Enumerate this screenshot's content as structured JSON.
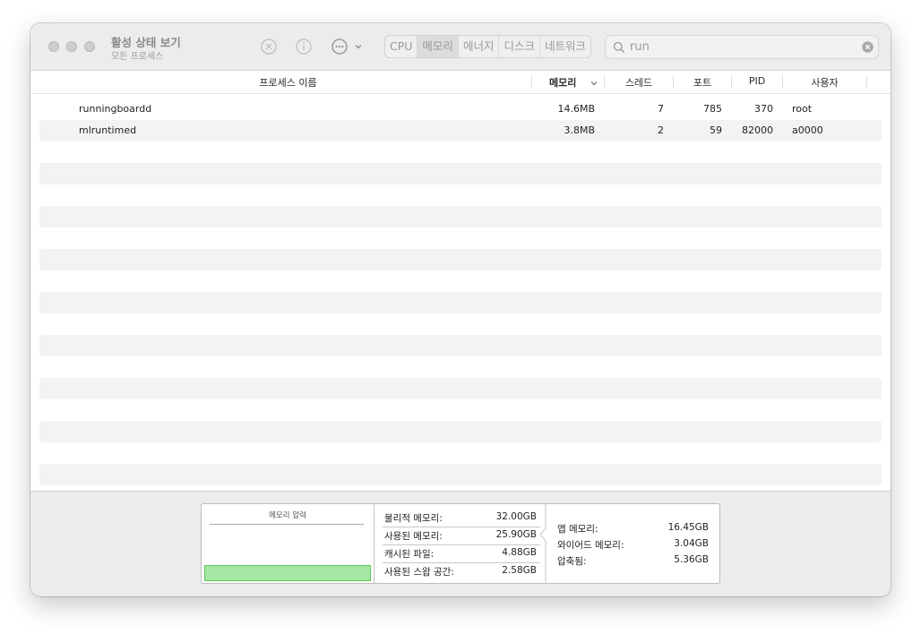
{
  "titlebar": {
    "title": "활성 상태 보기",
    "subtitle": "모든 프로세스",
    "icons": [
      "close-circle-icon",
      "info-icon",
      "more-icon",
      "chevron-down-icon"
    ]
  },
  "tabs": [
    {
      "label": "CPU",
      "active": false
    },
    {
      "label": "메모리",
      "active": true
    },
    {
      "label": "에너지",
      "active": false
    },
    {
      "label": "디스크",
      "active": false
    },
    {
      "label": "네트워크",
      "active": false
    }
  ],
  "search": {
    "value": "run"
  },
  "columns": {
    "name": "프로세스 이름",
    "memory": "메모리",
    "threads": "스레드",
    "ports": "포트",
    "pid": "PID",
    "user": "사용자"
  },
  "processes": [
    {
      "name": "runningboardd",
      "memory": "14.6MB",
      "threads": "7",
      "ports": "785",
      "pid": "370",
      "user": "root"
    },
    {
      "name": "mlruntimed",
      "memory": "3.8MB",
      "threads": "2",
      "ports": "59",
      "pid": "82000",
      "user": "a0000"
    }
  ],
  "footer": {
    "pressure_title": "메모리 압력",
    "pressure_color": "#a6e8a3",
    "stats_left": [
      {
        "label": "물리적 메모리:",
        "value": "32.00GB"
      },
      {
        "label": "사용된 메모리:",
        "value": "25.90GB"
      },
      {
        "label": "캐시된 파일:",
        "value": "4.88GB"
      },
      {
        "label": "사용된 스왑 공간:",
        "value": "2.58GB"
      }
    ],
    "stats_right": [
      {
        "label": "앱 메모리:",
        "value": "16.45GB"
      },
      {
        "label": "와이어드 메모리:",
        "value": "3.04GB"
      },
      {
        "label": "압축됨:",
        "value": "5.36GB"
      }
    ]
  }
}
